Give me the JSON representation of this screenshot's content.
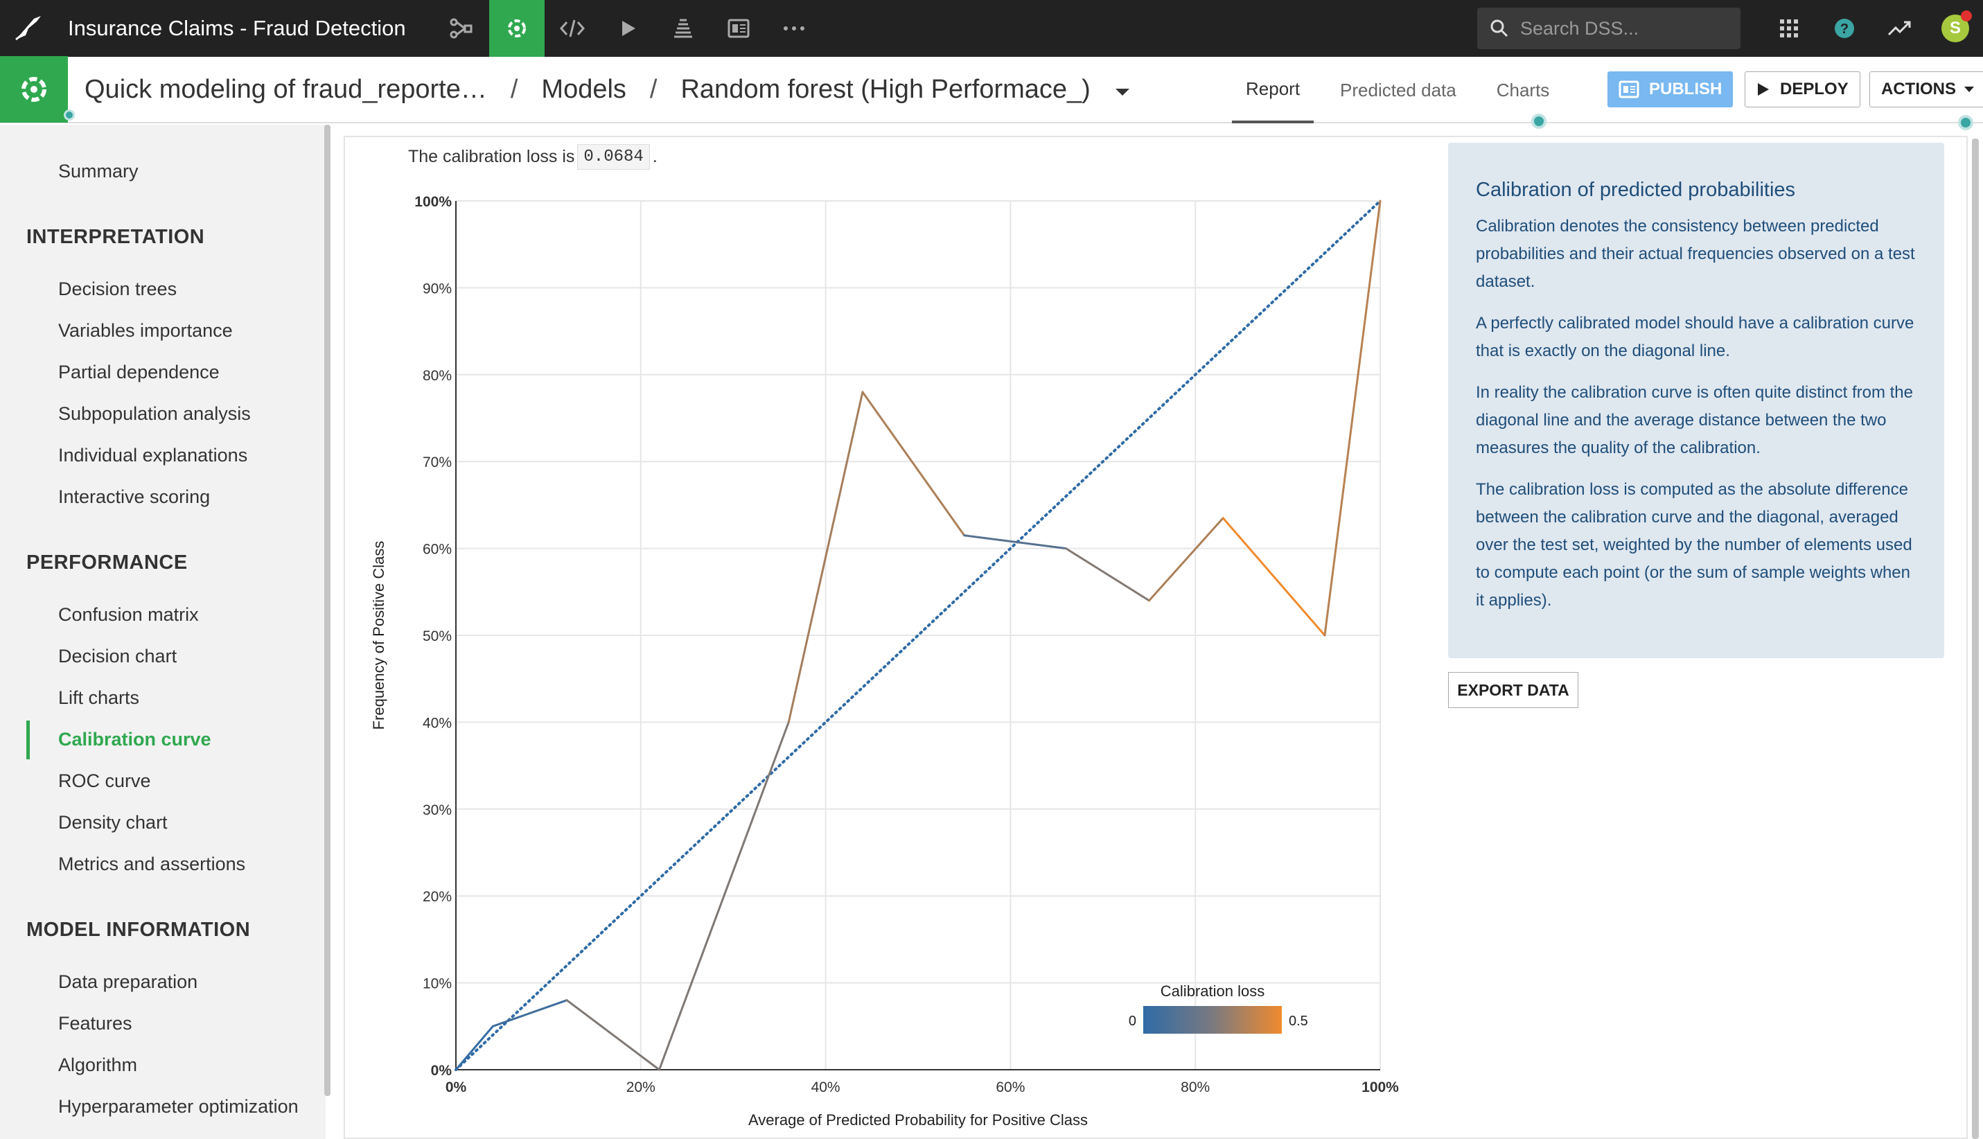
{
  "topbar": {
    "project_title": "Insurance Claims - Fraud Detection",
    "search_placeholder": "Search DSS...",
    "avatar_letter": "S",
    "icons": [
      "flow-icon",
      "lab-icon",
      "code-icon",
      "run-icon",
      "deploy-icon",
      "dashboard-icon",
      "more-icon"
    ]
  },
  "header": {
    "breadcrumb": [
      "Quick modeling of fraud_reporte…",
      "Models",
      "Random forest (High Performace_)"
    ],
    "tabs": [
      "Report",
      "Predicted data",
      "Charts"
    ],
    "active_tab": "Report",
    "publish_label": "PUBLISH",
    "deploy_label": "DEPLOY",
    "actions_label": "ACTIONS"
  },
  "sidebar": {
    "summary": "Summary",
    "sections": [
      {
        "title": "INTERPRETATION",
        "items": [
          "Decision trees",
          "Variables importance",
          "Partial dependence",
          "Subpopulation analysis",
          "Individual explanations",
          "Interactive scoring"
        ]
      },
      {
        "title": "PERFORMANCE",
        "items": [
          "Confusion matrix",
          "Decision chart",
          "Lift charts",
          "Calibration curve",
          "ROC curve",
          "Density chart",
          "Metrics and assertions"
        ]
      },
      {
        "title": "MODEL INFORMATION",
        "items": [
          "Data preparation",
          "Features",
          "Algorithm",
          "Hyperparameter optimization"
        ]
      }
    ],
    "active_item": "Calibration curve"
  },
  "main": {
    "loss_prefix": "The calibration loss is",
    "loss_value": "0.0684",
    "loss_suffix": ".",
    "export_label": "EXPORT DATA"
  },
  "info": {
    "title": "Calibration of predicted probabilities",
    "paragraphs": [
      "Calibration denotes the consistency between predicted probabilities and their actual frequencies observed on a test dataset.",
      "A perfectly calibrated model should have a calibration curve that is exactly on the diagonal line.",
      "In reality the calibration curve is often quite distinct from the diagonal line and the average distance between the two measures the quality of the calibration.",
      "The calibration loss is computed as the absolute difference between the calibration curve and the diagonal, averaged over the test set, weighted by the number of elements used to compute each point (or the sum of sample weights when it applies)."
    ]
  },
  "chart_data": {
    "type": "line",
    "xlabel": "Average of Predicted Probability for Positive Class",
    "ylabel": "Frequency of Positive Class",
    "xlim": [
      0,
      100
    ],
    "ylim": [
      0,
      100
    ],
    "x_ticks": [
      "0%",
      "20%",
      "40%",
      "60%",
      "80%",
      "100%"
    ],
    "y_ticks": [
      "0%",
      "10%",
      "20%",
      "30%",
      "40%",
      "50%",
      "60%",
      "70%",
      "80%",
      "90%",
      "100%"
    ],
    "grid": true,
    "series": [
      {
        "type": "calibration-curve",
        "x": [
          0,
          4,
          12,
          22,
          36,
          44,
          55,
          66,
          75,
          83,
          94,
          100
        ],
        "y": [
          0,
          5,
          8,
          0,
          40,
          78,
          61.5,
          60,
          54,
          63.5,
          50,
          100
        ]
      },
      {
        "type": "diagonal",
        "style": "dotted",
        "x": [
          0,
          100
        ],
        "y": [
          0,
          100
        ]
      }
    ],
    "colorscale": {
      "title": "Calibration loss",
      "min_label": "0",
      "max_label": "0.5",
      "min": 0,
      "max": 0.5,
      "colors": [
        "#2f6ba6",
        "#f08a2e"
      ]
    },
    "colors": {
      "diagonal": "#2f6ba6",
      "grid": "#e6e6e6",
      "axis": "#333333"
    }
  }
}
